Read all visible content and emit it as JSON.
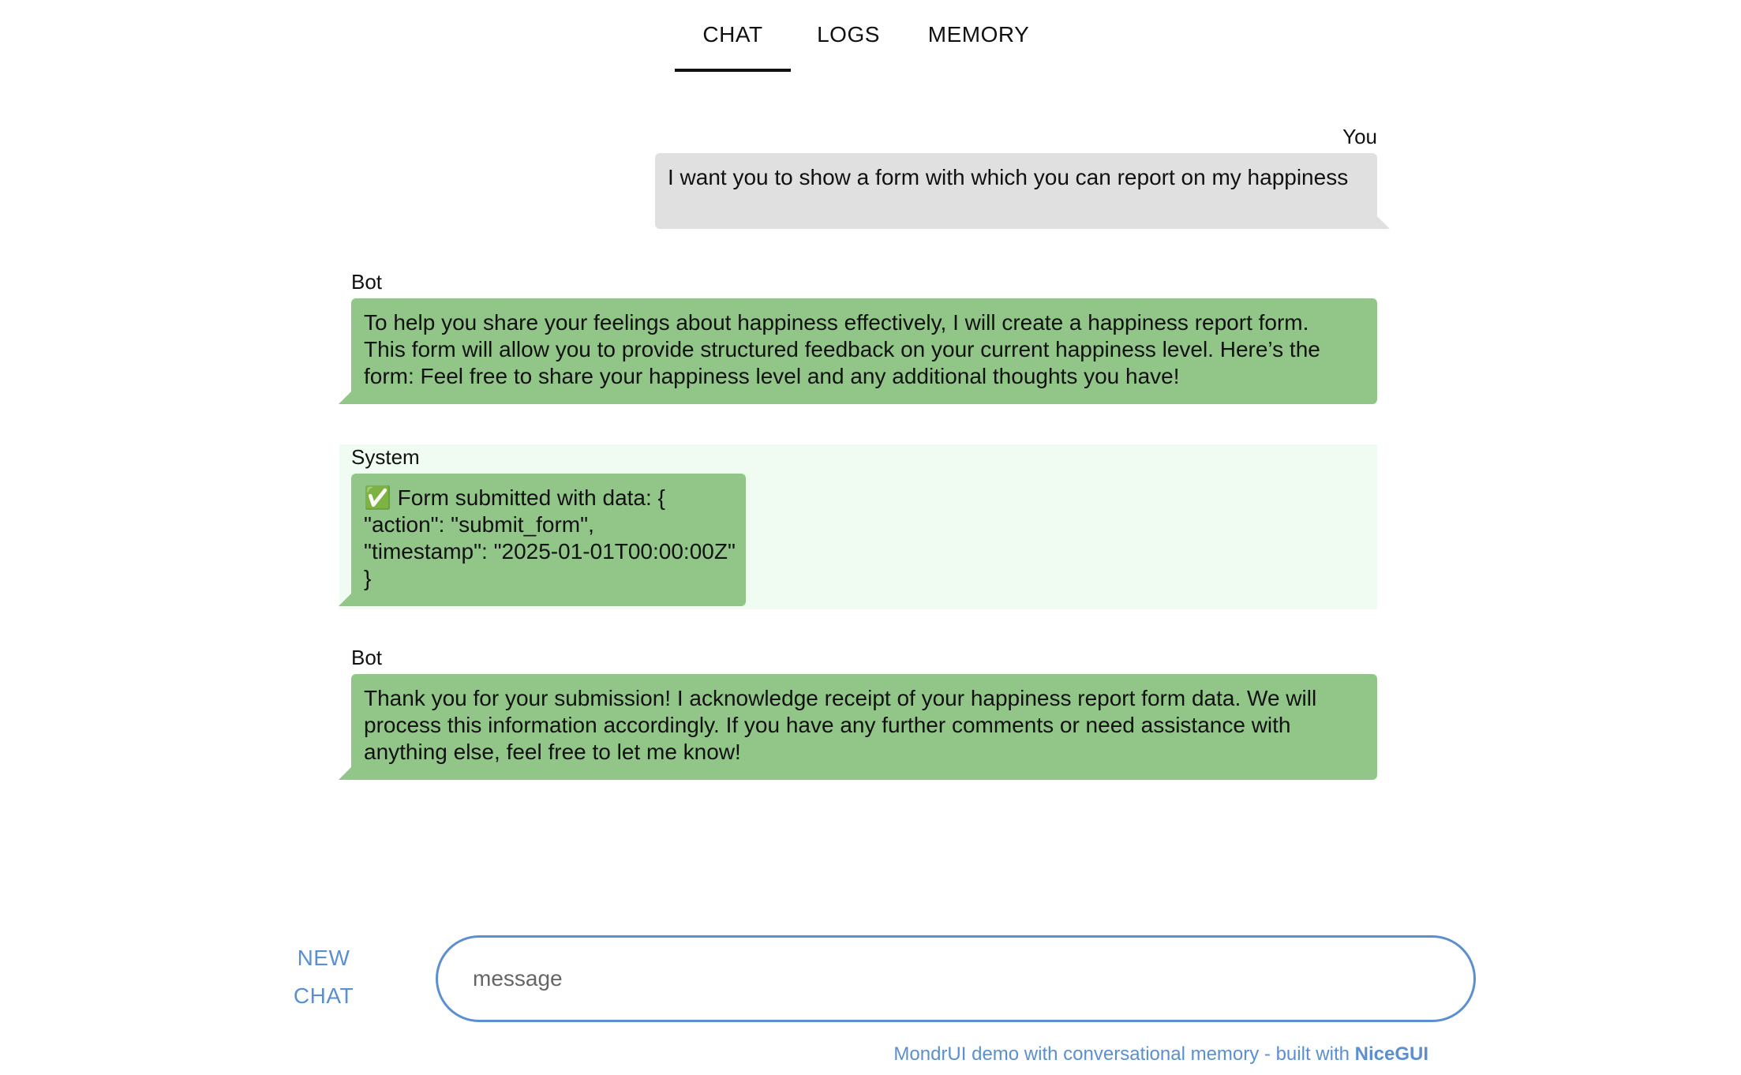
{
  "tabs": [
    {
      "label": "CHAT",
      "active": true
    },
    {
      "label": "LOGS",
      "active": false
    },
    {
      "label": "MEMORY",
      "active": false
    }
  ],
  "messages": [
    {
      "sender": "You",
      "side": "right",
      "lines": [
        "I want you to show a form with which you can report on my happiness"
      ]
    },
    {
      "sender": "Bot",
      "side": "left",
      "lines": [
        "To help you share your feelings about happiness effectively, I will create a happiness report form.",
        "This form will allow you to provide structured feedback on your current happiness level. Here’s the",
        "form: Feel free to share your happiness level and any additional thoughts you have!"
      ]
    },
    {
      "sender": "System",
      "side": "left",
      "lines": [
        "✅ Form submitted with data: {",
        "\"action\": \"submit_form\",",
        "\"timestamp\": \"2025-01-01T00:00:00Z\"",
        "}"
      ]
    },
    {
      "sender": "Bot",
      "side": "left",
      "lines": [
        "Thank you for your submission! I acknowledge receipt of your happiness report form data. We will",
        "process this information accordingly. If you have any further comments or need assistance with",
        "anything else, feel free to let me know!"
      ]
    }
  ],
  "composer": {
    "new_chat_line1": "NEW",
    "new_chat_line2": "CHAT",
    "placeholder": "message",
    "value": ""
  },
  "footer": {
    "text": "MondrUI demo with conversational memory - built with ",
    "brand": "NiceGUI"
  },
  "colors": {
    "user_bubble": "#e0e0e0",
    "bot_bubble": "#92c688",
    "system_row_bg": "#f0fbf1",
    "accent": "#5b8fd0"
  }
}
